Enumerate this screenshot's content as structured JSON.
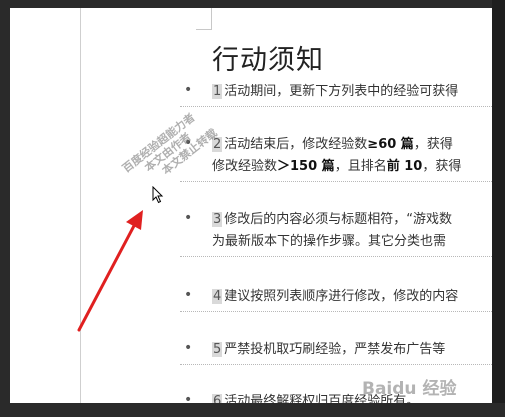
{
  "document": {
    "title": "行动须知",
    "items": [
      {
        "number": "1",
        "lines": [
          {
            "parts": [
              {
                "t": "活动期间，更新下方列表中的经验可获得"
              }
            ]
          }
        ]
      },
      {
        "number": "2",
        "lines": [
          {
            "parts": [
              {
                "t": "活动结束后，修改经验数"
              },
              {
                "t": "≥60 篇",
                "bold": true
              },
              {
                "t": "，获得"
              }
            ]
          },
          {
            "parts": [
              {
                "t": "修改经验数"
              },
              {
                "t": "＞150 篇",
                "bold": true
              },
              {
                "t": "，且排名"
              },
              {
                "t": "前 10",
                "bold": true
              },
              {
                "t": "，获得"
              }
            ]
          }
        ]
      },
      {
        "number": "3",
        "lines": [
          {
            "parts": [
              {
                "t": "修改后的内容必须与标题相符，“游戏数"
              }
            ]
          },
          {
            "parts": [
              {
                "t": "为最新版本下的操作步骤。其它分类也需"
              }
            ]
          }
        ]
      },
      {
        "number": "4",
        "lines": [
          {
            "parts": [
              {
                "t": "建议按照列表顺序进行修改，修改的内容"
              }
            ]
          }
        ]
      },
      {
        "number": "5",
        "lines": [
          {
            "parts": [
              {
                "t": "严禁投机取巧刷经验，严禁发布广告等"
              }
            ]
          }
        ]
      },
      {
        "number": "6",
        "lines": [
          {
            "parts": [
              {
                "t": "活动最终解释权归百度经验所有。"
              }
            ]
          }
        ]
      }
    ]
  },
  "watermark": {
    "lines": [
      "百度经验超能力者",
      "本文由作者",
      "本文禁止转载"
    ]
  },
  "baidu_logo_text": "Baidu 经验",
  "colors": {
    "arrow": "#e02020",
    "text": "#333333",
    "number_highlight": "#d9d9d9"
  }
}
